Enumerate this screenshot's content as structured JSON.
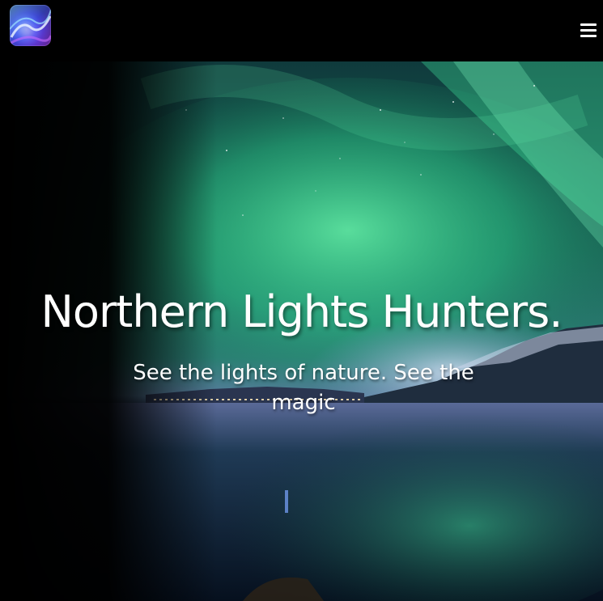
{
  "header": {
    "logo_icon": "aurora-logo-icon",
    "menu_icon": "hamburger-menu-icon"
  },
  "hero": {
    "title": "Northern Lights Hunters.",
    "subtitle": "See the lights of nature. See the magic"
  },
  "colors": {
    "background": "#000000",
    "aurora_green": "#3fd98f",
    "text": "#ffffff"
  }
}
